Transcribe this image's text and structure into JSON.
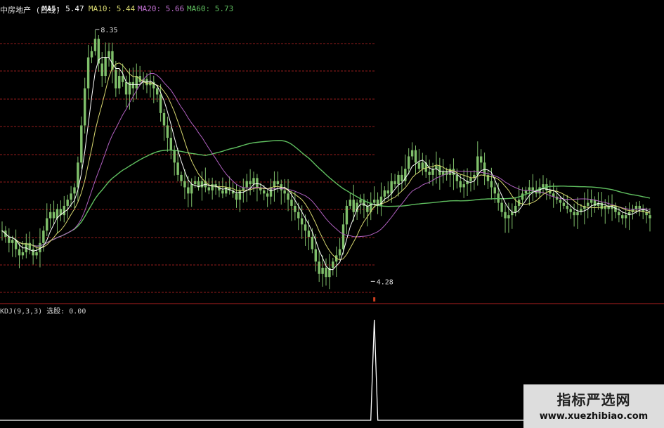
{
  "header": {
    "stock": "中房地产 (日线)",
    "ma5": "MA5: 5.47",
    "ma10": "MA10: 5.44",
    "ma20": "MA20: 5.66",
    "ma60": "MA60: 5.73"
  },
  "kdj_header": "KDJ(9,3,3) 选股: 0.00",
  "watermark": {
    "title": "指标严选网",
    "url": "www.xuezhibiao.com"
  },
  "colors": {
    "background": "#000000",
    "candle": "#7fbf6a",
    "ma5": "#ffffff",
    "ma10": "#d8d870",
    "ma20": "#b060c0",
    "ma60": "#60c060",
    "grid": "#b02020",
    "signal": "#ffffff"
  },
  "chart_data": [
    {
      "type": "candlestick",
      "title": "",
      "xlabel": "",
      "ylabel": "",
      "ylim": [
        4.0,
        8.6
      ],
      "grid": true,
      "annotations": [
        {
          "text": "8.35",
          "value": 8.35,
          "index": 27
        },
        {
          "text": "4.28",
          "value": 4.28,
          "index": 107
        }
      ],
      "series": [
        {
          "name": "MA5: 5.47",
          "color": "#ffffff"
        },
        {
          "name": "MA10: 5.44",
          "color": "#d8d870"
        },
        {
          "name": "MA20: 5.66",
          "color": "#b060c0"
        },
        {
          "name": "MA60: 5.73",
          "color": "#60c060"
        }
      ],
      "close": [
        5.1,
        5.0,
        4.9,
        4.95,
        4.8,
        4.7,
        4.75,
        4.9,
        4.8,
        4.7,
        4.75,
        4.9,
        5.1,
        5.3,
        5.4,
        5.3,
        5.45,
        5.35,
        5.5,
        5.6,
        5.7,
        5.8,
        6.2,
        6.8,
        7.4,
        7.9,
        8.0,
        8.2,
        7.8,
        7.6,
        7.9,
        8.0,
        7.7,
        7.4,
        7.6,
        7.5,
        7.3,
        7.5,
        7.4,
        7.6,
        7.5,
        7.55,
        7.45,
        7.5,
        7.4,
        7.3,
        7.0,
        6.8,
        6.6,
        6.4,
        6.2,
        6.0,
        5.9,
        5.8,
        5.7,
        5.85,
        5.9,
        5.8,
        5.9,
        5.8,
        5.75,
        5.85,
        5.8,
        5.75,
        5.7,
        5.8,
        5.75,
        5.7,
        5.6,
        5.75,
        5.8,
        5.9,
        5.85,
        5.95,
        5.8,
        5.75,
        5.7,
        5.65,
        5.8,
        5.9,
        5.85,
        5.75,
        5.7,
        5.6,
        5.5,
        5.4,
        5.3,
        5.2,
        5.1,
        5.0,
        4.8,
        4.6,
        4.4,
        4.5,
        4.35,
        4.5,
        4.6,
        4.7,
        4.8,
        5.2,
        5.5,
        5.6,
        5.4,
        5.55,
        5.6,
        5.5,
        5.4,
        5.55,
        5.6,
        5.5,
        5.65,
        5.75,
        5.7,
        5.9,
        5.85,
        6.0,
        5.9,
        6.1,
        6.3,
        6.4,
        6.2,
        6.1,
        6.2,
        6.05,
        6.0,
        6.1,
        6.15,
        6.0,
        6.05,
        6.0,
        6.1,
        6.0,
        5.9,
        5.8,
        5.85,
        5.9,
        5.95,
        6.0,
        6.3,
        6.2,
        6.0,
        5.9,
        5.8,
        5.7,
        5.55,
        5.4,
        5.3,
        5.35,
        5.4,
        5.5,
        5.6,
        5.7,
        5.75,
        5.8,
        5.75,
        5.7,
        5.8,
        5.85,
        5.75,
        5.7,
        5.65,
        5.6,
        5.55,
        5.5,
        5.45,
        5.4,
        5.35,
        5.4,
        5.45,
        5.5,
        5.55,
        5.6,
        5.5,
        5.55,
        5.45,
        5.5,
        5.45,
        5.5,
        5.4,
        5.35,
        5.3,
        5.35,
        5.4,
        5.45,
        5.5,
        5.45,
        5.4,
        5.35,
        5.3
      ]
    },
    {
      "type": "line",
      "title": "",
      "xlabel": "",
      "ylabel": "",
      "name": "KDJ(9,3,3) 选股: 0.00",
      "ylim": [
        0,
        1
      ],
      "signal_index": 108,
      "values": [
        0,
        1,
        0
      ]
    }
  ]
}
